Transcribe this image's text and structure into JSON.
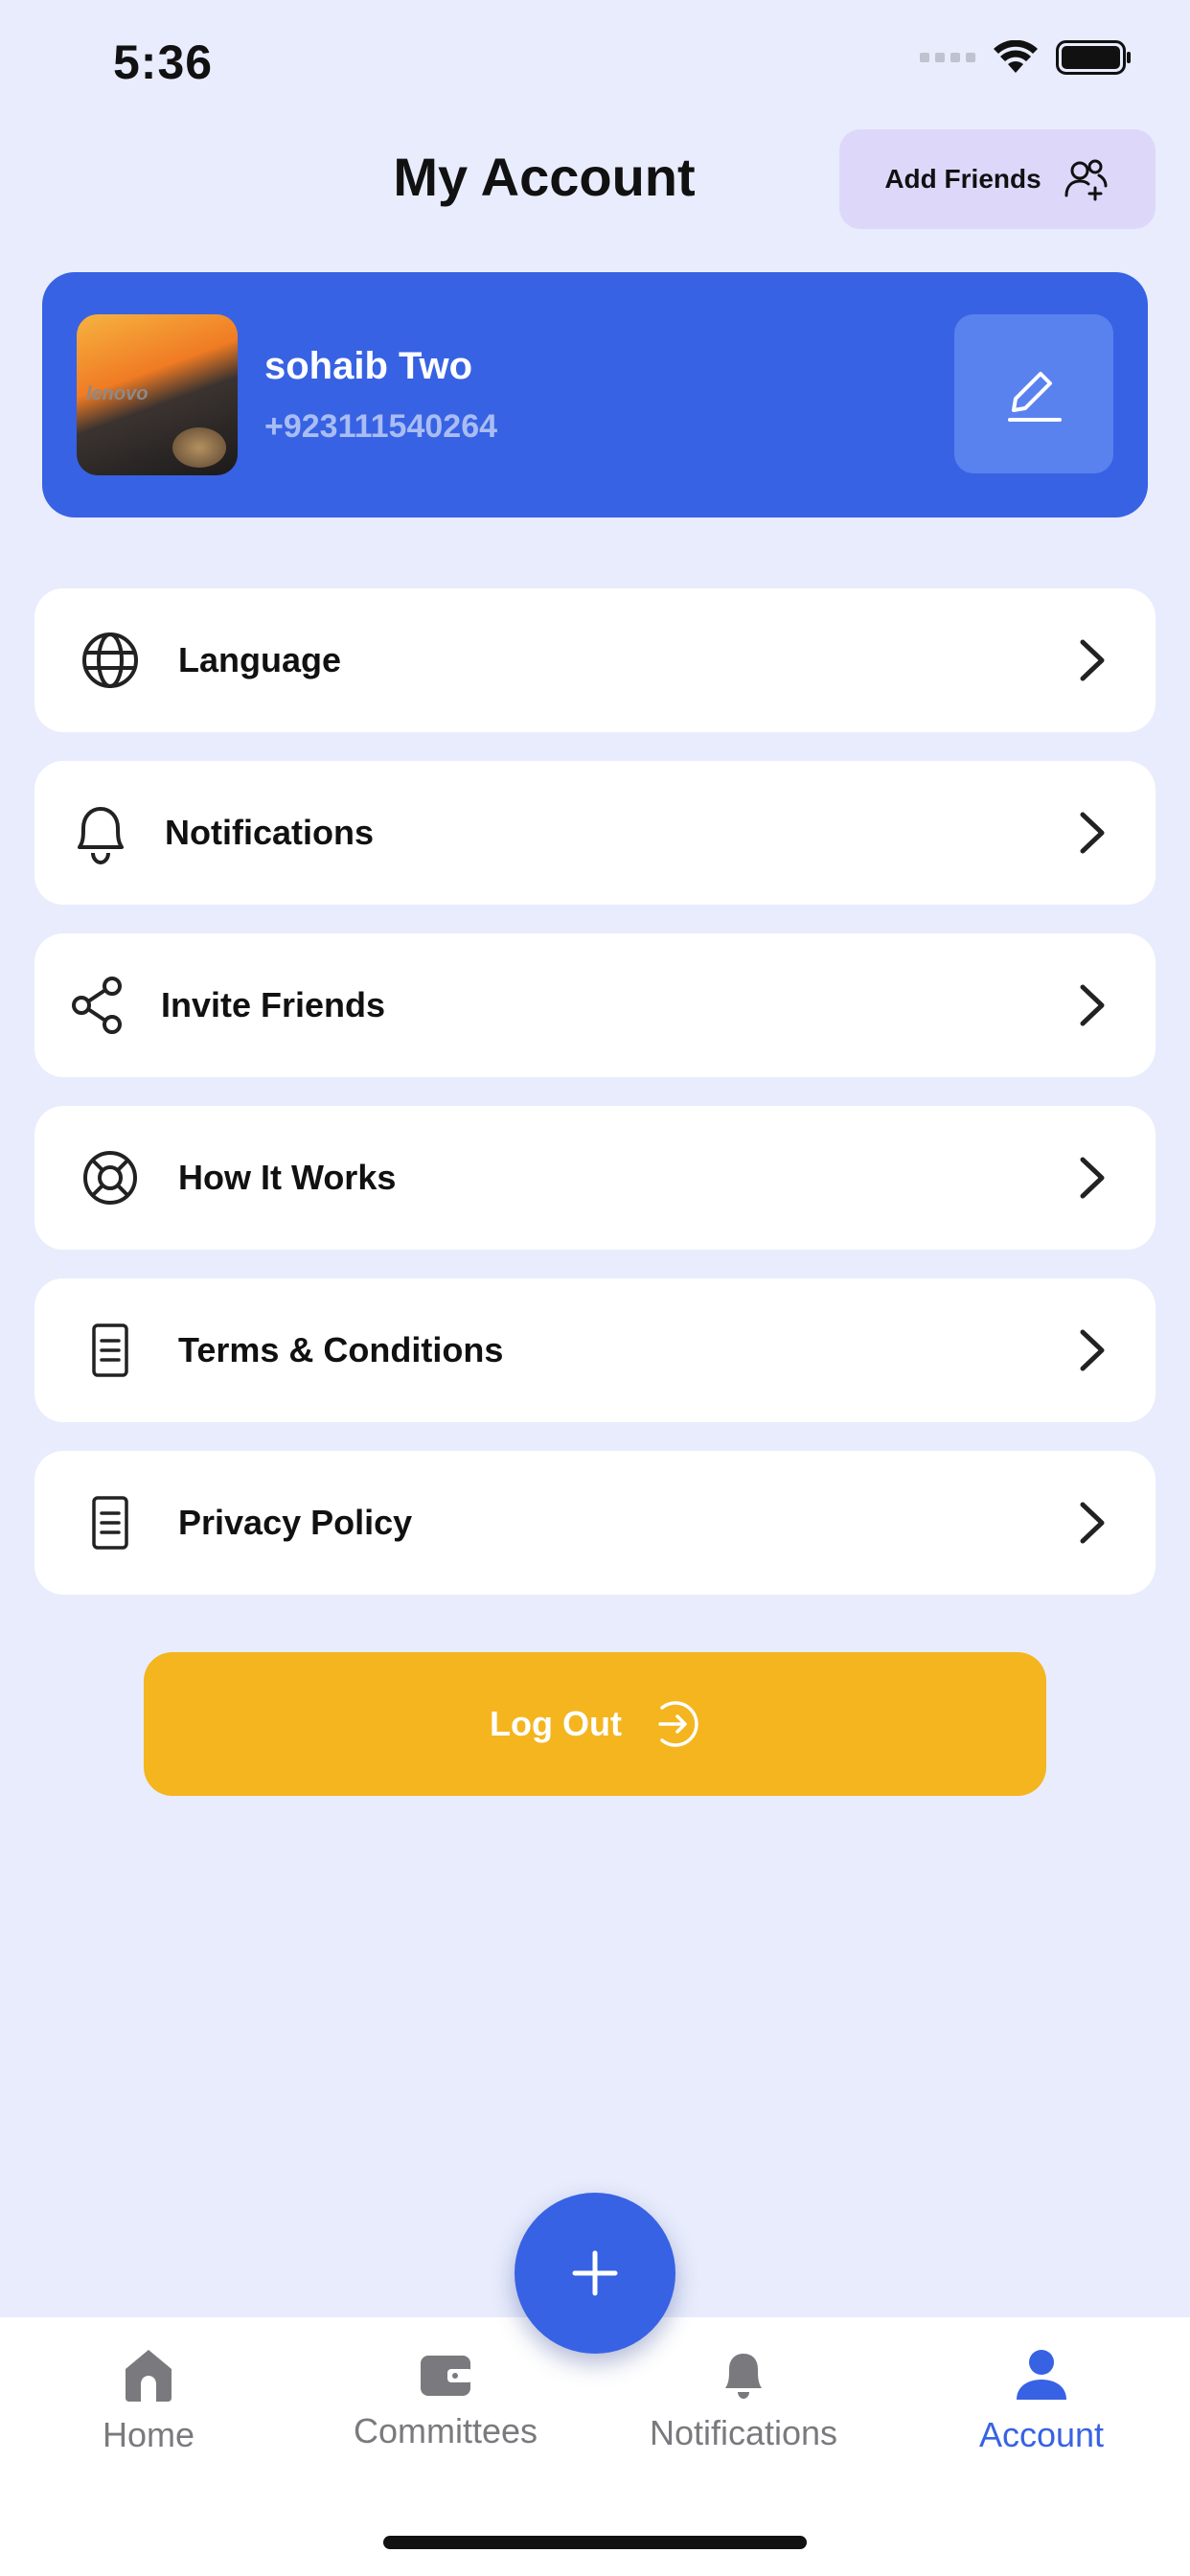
{
  "status_bar": {
    "time": "5:36"
  },
  "header": {
    "title": "My Account",
    "add_friends_label": "Add Friends"
  },
  "profile": {
    "name": "sohaib Two",
    "phone": "+923111540264",
    "avatar_text": "lenovo"
  },
  "menu": {
    "items": [
      {
        "label": "Language",
        "icon": "globe-icon"
      },
      {
        "label": "Notifications",
        "icon": "bell-icon"
      },
      {
        "label": "Invite Friends",
        "icon": "share-icon"
      },
      {
        "label": "How It Works",
        "icon": "lifebuoy-icon"
      },
      {
        "label": "Terms & Conditions",
        "icon": "document-icon"
      },
      {
        "label": "Privacy Policy",
        "icon": "document-icon"
      }
    ]
  },
  "logout": {
    "label": "Log Out"
  },
  "tabbar": {
    "tabs": [
      {
        "label": "Home",
        "icon": "home-icon",
        "active": false
      },
      {
        "label": "Committees",
        "icon": "wallet-icon",
        "active": false
      },
      {
        "label": "Notifications",
        "icon": "bell-icon",
        "active": false
      },
      {
        "label": "Account",
        "icon": "user-icon",
        "active": true
      }
    ],
    "fab_icon": "plus-icon"
  },
  "colors": {
    "background": "#E8ECFC",
    "primary": "#3762E4",
    "logout": "#F4B51F",
    "add_friends_bg": "#DDD8FA"
  }
}
